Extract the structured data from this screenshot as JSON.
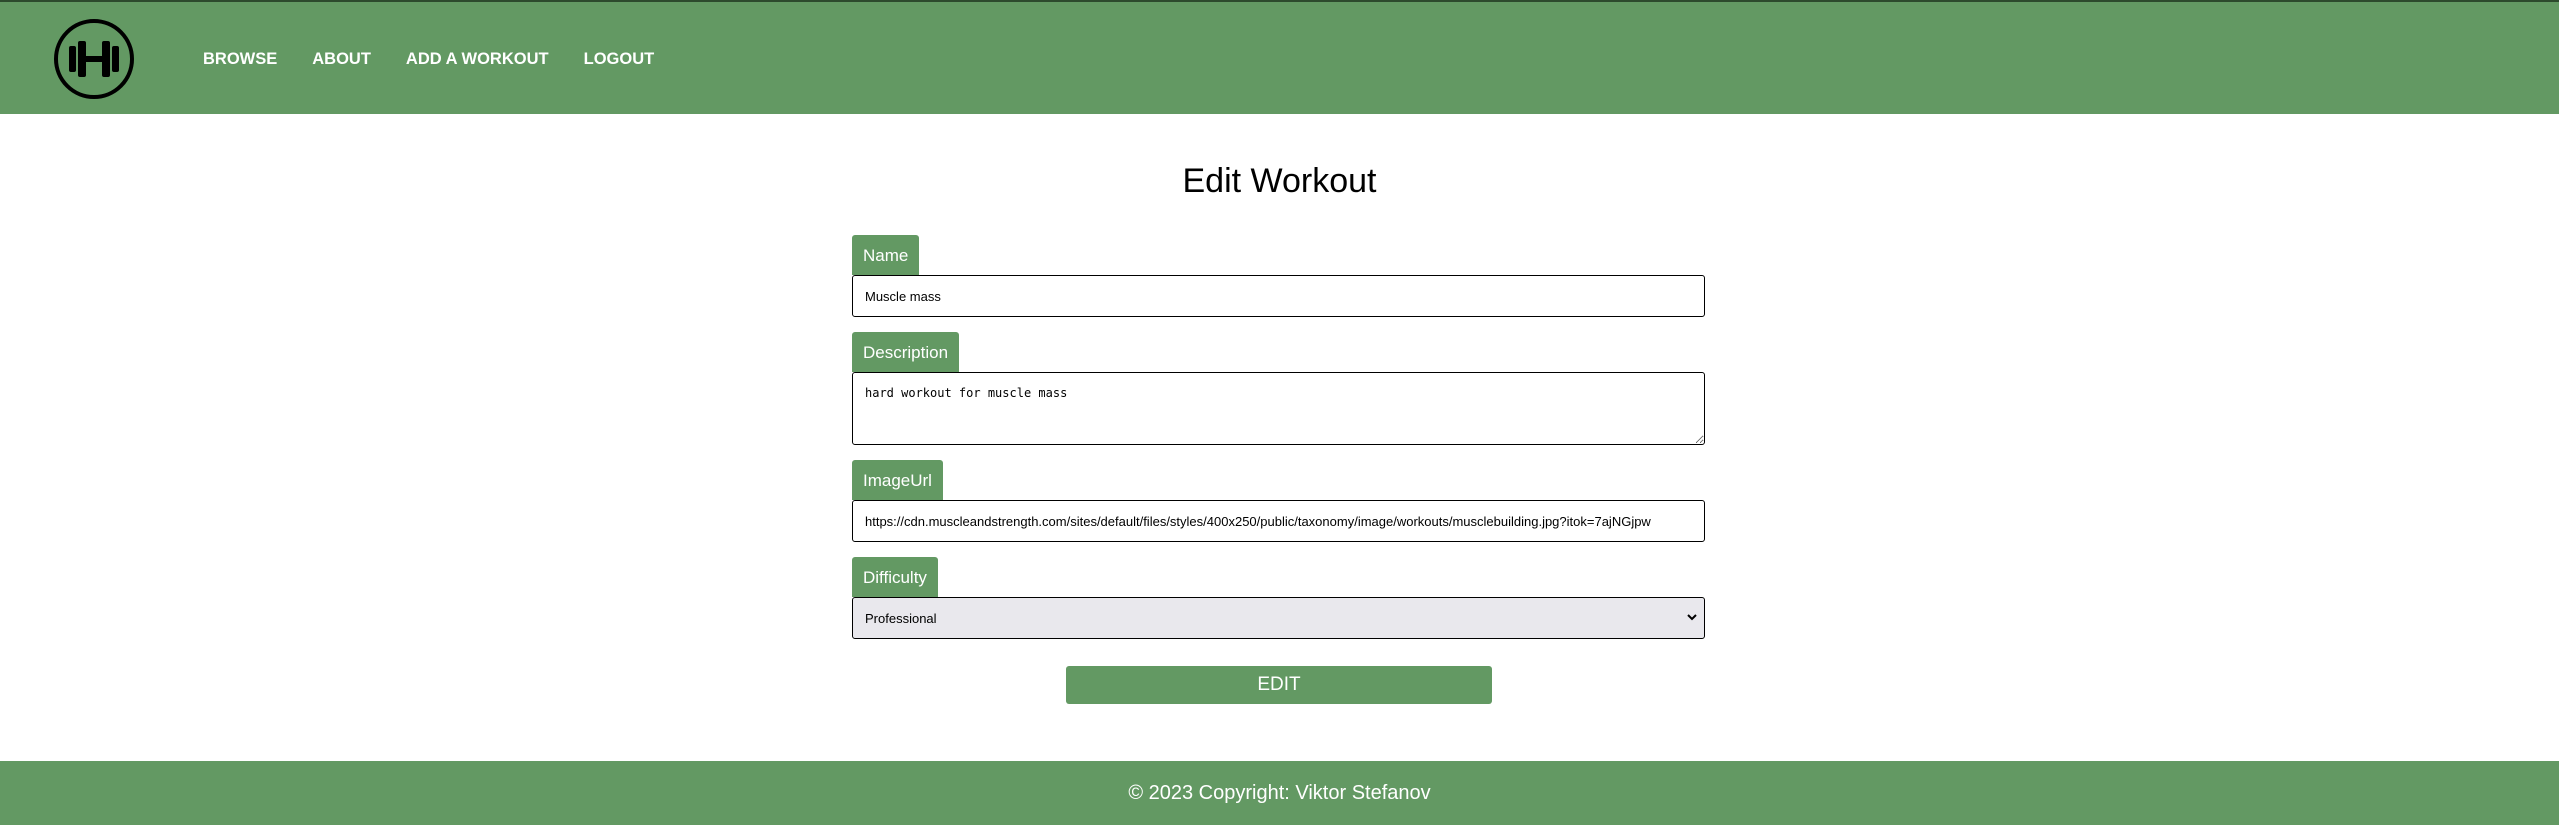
{
  "nav": {
    "logo_icon": "dumbbell-icon",
    "items": [
      {
        "label": "BROWSE"
      },
      {
        "label": "ABOUT"
      },
      {
        "label": "ADD A WORKOUT"
      },
      {
        "label": "LOGOUT"
      }
    ]
  },
  "page": {
    "title": "Edit Workout"
  },
  "form": {
    "name": {
      "label": "Name",
      "value": "Muscle mass"
    },
    "description": {
      "label": "Description",
      "value": "hard workout for muscle mass"
    },
    "image_url": {
      "label": "ImageUrl",
      "value": "https://cdn.muscleandstrength.com/sites/default/files/styles/400x250/public/taxonomy/image/workouts/musclebuilding.jpg?itok=7ajNGjpw"
    },
    "difficulty": {
      "label": "Difficulty",
      "value": "Professional",
      "chevron_icon": "chevron-down-icon"
    },
    "submit_label": "EDIT"
  },
  "footer": {
    "text": "© 2023 Copyright: Viktor Stefanov"
  },
  "colors": {
    "accent": "#639963",
    "select_bg": "#e9e8ed"
  }
}
